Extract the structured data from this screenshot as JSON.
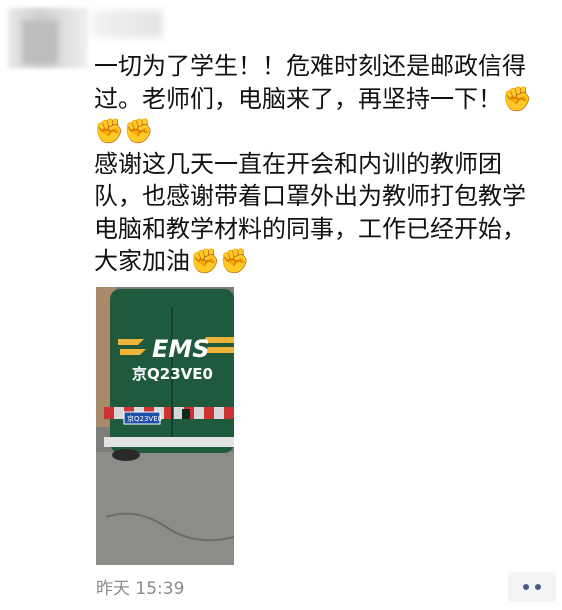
{
  "post": {
    "text": "一切为了学生！！危难时刻还是邮政信得过。老师们，电脑来了，再坚持一下！✊✊✊\n感谢这几天一直在开会和内训的教师团队，也感谢带着口罩外出为教师打包教学电脑和教学材料的同事，工作已经开始，大家加油✊✊",
    "photo": {
      "logo_text": "EMS",
      "plate_text": "京Q23VE0",
      "small_plate_text": "京Q23VE0"
    },
    "timestamp": "昨天 15:39"
  },
  "colors": {
    "van_green": "#1f5a3c",
    "accent_gold": "#f0b33a",
    "timestamp_gray": "#8c8c8c",
    "more_dots": "#4a5b80"
  }
}
